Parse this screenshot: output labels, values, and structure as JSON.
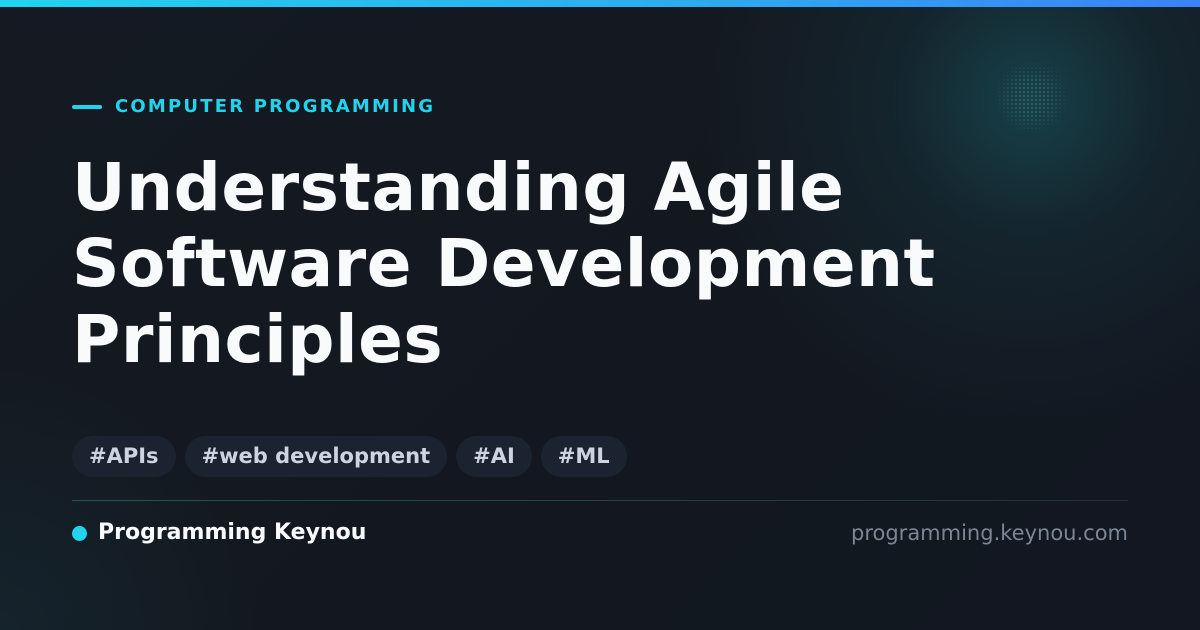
{
  "category": "COMPUTER PROGRAMMING",
  "title_lines": [
    "Understanding Agile",
    "Software Development",
    "Principles"
  ],
  "tags": [
    "#APIs",
    "#web development",
    "#AI",
    "#ML"
  ],
  "footer": {
    "brand_name": "Programming Keynou",
    "site_url": "programming.keynou.com"
  },
  "colors": {
    "accent": "#22d3ee",
    "background": "#131820",
    "title": "#f8fafc",
    "tag_background": "#1b2330",
    "tag_text": "#cbd5e1",
    "muted_text": "#7b8696"
  }
}
